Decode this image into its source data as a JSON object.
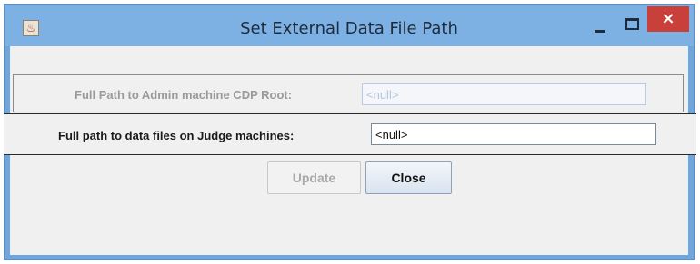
{
  "window": {
    "title": "Set External Data File Path",
    "icon": "java-icon",
    "controls": {
      "minimize": "–",
      "maximize": "☐",
      "close": "×"
    }
  },
  "form": {
    "admin_root": {
      "label": "Full Path to Admin machine CDP Root:",
      "value": "<null>",
      "enabled": false
    },
    "judge_path": {
      "label": "Full path to data files on Judge machines:",
      "value": "<null>",
      "enabled": true
    }
  },
  "buttons": {
    "update": "Update",
    "close": "Close"
  },
  "colors": {
    "titlebar": "#7db0e3",
    "close_button": "#c9403a",
    "panel": "#f0f0f0"
  }
}
